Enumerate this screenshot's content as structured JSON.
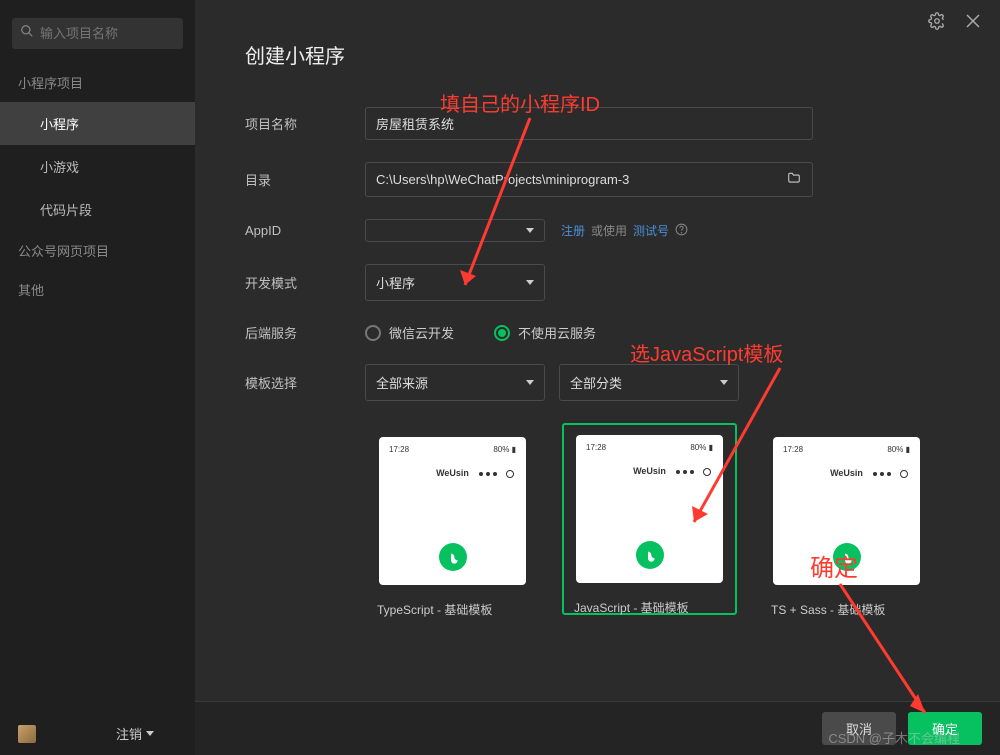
{
  "search": {
    "placeholder": "输入项目名称"
  },
  "sidebar": {
    "section1": "小程序项目",
    "items1": [
      "小程序",
      "小游戏",
      "代码片段"
    ],
    "section2": "公众号网页项目",
    "section3": "其他",
    "logout": "注销"
  },
  "main": {
    "title": "创建小程序",
    "labels": {
      "name": "项目名称",
      "dir": "目录",
      "appid": "AppID",
      "mode": "开发模式",
      "backend": "后端服务",
      "template": "模板选择"
    },
    "values": {
      "name": "房屋租赁系统",
      "dir": "C:\\Users\\hp\\WeChatProjects\\miniprogram-3",
      "appid": "",
      "mode": "小程序",
      "source": "全部来源",
      "category": "全部分类"
    },
    "appid_extra": {
      "register": "注册",
      "or_use": "或使用",
      "test": "测试号"
    },
    "backend_options": {
      "cloud": "微信云开发",
      "none": "不使用云服务"
    },
    "templates": [
      {
        "name": "TypeScript - 基础模板",
        "header": "WeUsin",
        "time": "17:28"
      },
      {
        "name": "JavaScript - 基础模板",
        "header": "WeUsin",
        "time": "17:28"
      },
      {
        "name": "TS + Sass - 基础模板",
        "header": "WeUsin",
        "time": "17:28"
      }
    ]
  },
  "footer": {
    "cancel": "取消",
    "confirm": "确定"
  },
  "annotations": {
    "appid": "填自己的小程序ID",
    "template": "选JavaScript模板",
    "confirm": "确定"
  },
  "watermark": "CSDN @子木不会编程"
}
